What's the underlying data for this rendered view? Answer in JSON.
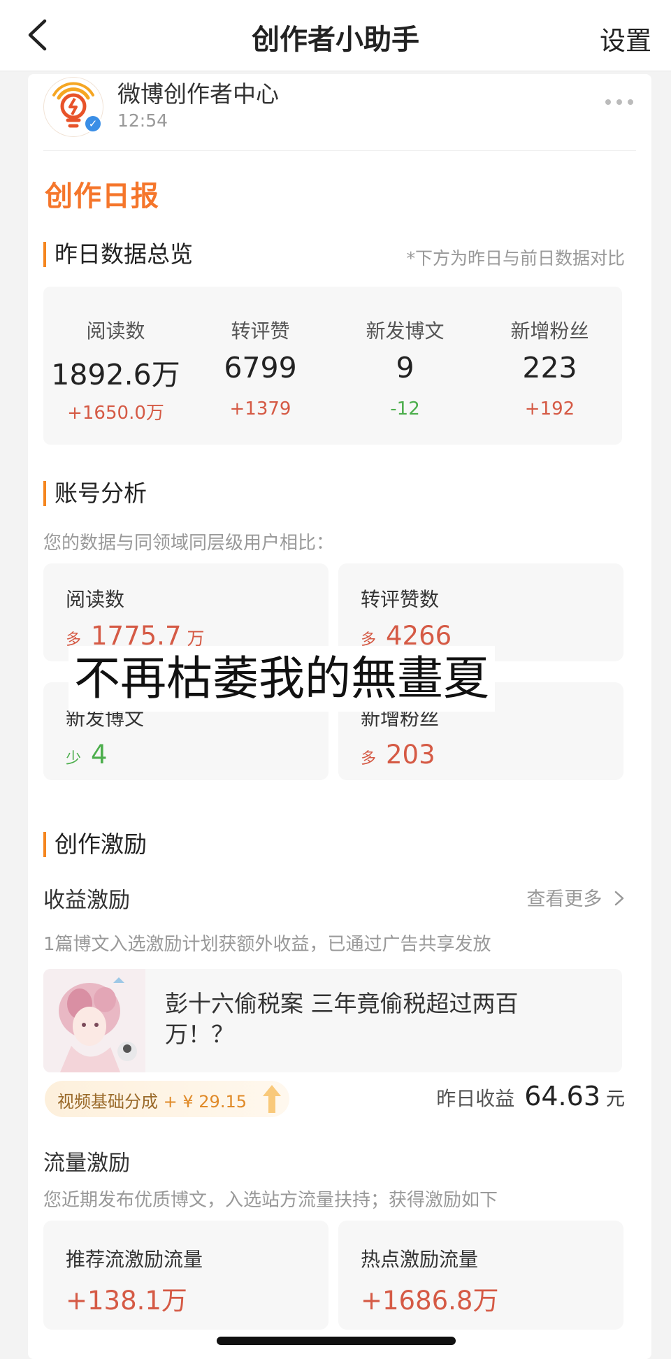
{
  "nav": {
    "title": "创作者小助手",
    "right": "设置"
  },
  "account": {
    "name": "微博创作者中心",
    "time": "12:54"
  },
  "report_title": "创作日报",
  "overview": {
    "title": "昨日数据总览",
    "note": "*下方为昨日与前日数据对比",
    "items": [
      {
        "label": "阅读数",
        "value": "1892.6万",
        "delta": "+1650.0万"
      },
      {
        "label": "转评赞",
        "value": "6799",
        "delta": "+1379"
      },
      {
        "label": "新发博文",
        "value": "9",
        "delta": "-12"
      },
      {
        "label": "新增粉丝",
        "value": "223",
        "delta": "+192"
      }
    ]
  },
  "analysis": {
    "title": "账号分析",
    "desc": "您的数据与同领域同层级用户相比：",
    "items": [
      {
        "label": "阅读数",
        "tag": "多",
        "value": "1775.7",
        "unit": "万"
      },
      {
        "label": "转评赞数",
        "tag": "多",
        "value": "4266",
        "unit": ""
      },
      {
        "label": "新发博文",
        "tag": "少",
        "value": "4",
        "unit": ""
      },
      {
        "label": "新增粉丝",
        "tag": "多",
        "value": "203",
        "unit": ""
      }
    ]
  },
  "overlay_caption": "不再枯萎我的無畫夏",
  "incentive": {
    "title": "创作激励",
    "revenue": {
      "title": "收益激励",
      "more": "查看更多",
      "desc": "1篇博文入选激励计划获额外收益，已通过广告共享发放",
      "post_title": "彭十六偷税案 三年竟偷税超过两百万！？",
      "pill_label": "视频基础分成",
      "pill_amount": "+ ¥ 29.15",
      "earn_label": "昨日收益",
      "earn_value": "64.63",
      "earn_unit": "元"
    },
    "traffic": {
      "title": "流量激励",
      "desc": "您近期发布优质博文，入选站方流量扶持；获得激励如下",
      "items": [
        {
          "label": "推荐流激励流量",
          "value": "+138.1万"
        },
        {
          "label": "热点激励流量",
          "value": "+1686.8万"
        }
      ]
    }
  },
  "colors": {
    "accent": "#f5762b",
    "up": "#d55a45",
    "down": "#4cae4c"
  }
}
